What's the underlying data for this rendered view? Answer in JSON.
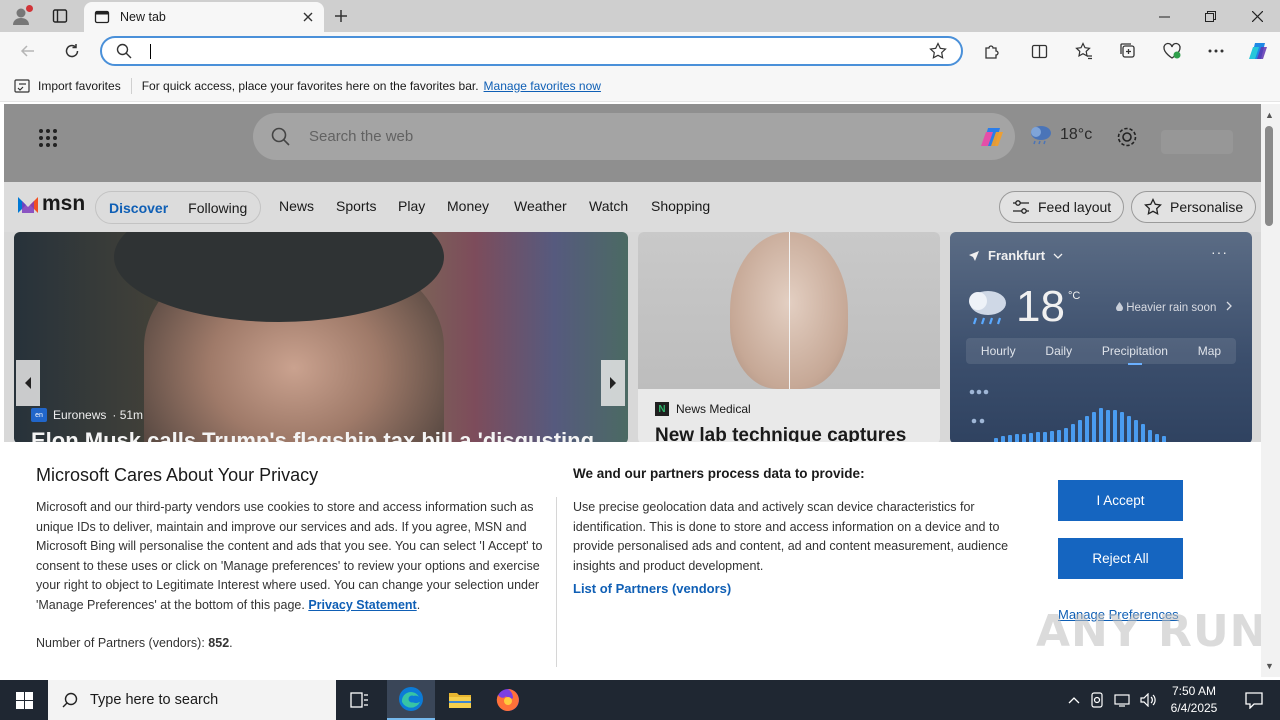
{
  "browser": {
    "tab_title": "New tab",
    "address_value": "",
    "favbar": {
      "import_label": "Import favorites",
      "hint": "For quick access, place your favorites here on the favorites bar.",
      "manage_link": "Manage favorites now"
    }
  },
  "msn": {
    "search_placeholder": "Search the web",
    "weather_mini": "18°c",
    "logo": "msn",
    "pills": [
      "Discover",
      "Following"
    ],
    "nav": [
      "News",
      "Sports",
      "Play",
      "Money",
      "Weather",
      "Watch",
      "Shopping"
    ],
    "feed_layout": "Feed layout",
    "personalise": "Personalise",
    "hero": {
      "source": "Euronews",
      "age": "· 51m",
      "badge": "en",
      "headline": "Elon Musk calls Trump's flagship tax bill a 'disgusting"
    },
    "card2": {
      "source": "News Medical",
      "headline": "New lab technique captures"
    },
    "weather": {
      "location": "Frankfurt",
      "temp": "18",
      "unit": "°C",
      "condition": "Heavier rain soon",
      "tabs": [
        "Hourly",
        "Daily",
        "Precipitation",
        "Map"
      ],
      "selected_tab": "Precipitation"
    }
  },
  "privacy": {
    "title": "Microsoft Cares About Your Privacy",
    "left_text": "Microsoft and our third-party vendors use cookies to store and access information such as unique IDs to deliver, maintain and improve our services and ads. If you agree, MSN and Microsoft Bing will personalise the content and ads that you see. You can select 'I Accept' to consent to these uses or click on 'Manage preferences' to review your options and exercise your right to object to Legitimate Interest where used.  You can change your selection under 'Manage Preferences' at the bottom of this page.",
    "privacy_link": "Privacy Statement",
    "partners_label": "Number of Partners (vendors):",
    "partners_count": "852",
    "right_title": "We and our partners process data to provide:",
    "right_text": "Use precise geolocation data and actively scan device characteristics for identification. This is done to store and access information on a device and to provide personalised ads and content, ad and content measurement, audience insights and product development.",
    "vendors_link": "List of Partners (vendors)",
    "accept": "I Accept",
    "reject": "Reject All",
    "manage": "Manage Preferences"
  },
  "watermark": "ANY RUN",
  "taskbar": {
    "search_placeholder": "Type here to search",
    "time": "7:50 AM",
    "date": "6/4/2025"
  },
  "colors": {
    "accent": "#1565c0",
    "link": "#0f5fb5",
    "taskbar": "#1f2732"
  }
}
